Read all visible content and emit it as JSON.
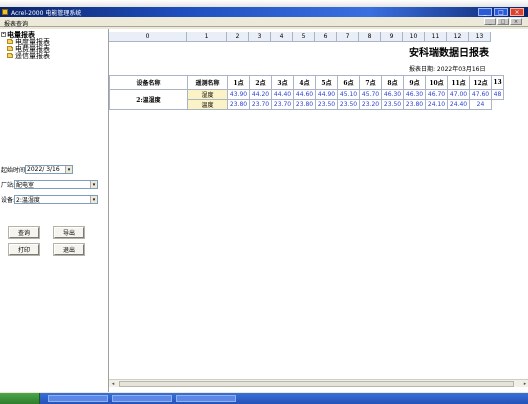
{
  "window": {
    "title": "Acrel-2000 电能管理系统",
    "controls": [
      "_",
      "□",
      "×"
    ]
  },
  "menubar": {
    "item": "报表查询",
    "mdi_controls": [
      "_",
      "□",
      "×"
    ]
  },
  "tree": {
    "root": "电量报表",
    "expander": "-",
    "items": [
      "电度量报表",
      "电费量报表",
      "遥信量报表"
    ]
  },
  "query": {
    "start_label": "起始时间:",
    "start_value": "2022/ 3/16",
    "station_label": "厂站:",
    "station_value": "配电室",
    "device_label": "设备:",
    "device_value": "2:温湿度",
    "buttons": {
      "query": "查询",
      "export": "导出",
      "print": "打印",
      "exit": "退出"
    },
    "dropdown_glyph": "▾"
  },
  "report": {
    "column_headers": [
      "0",
      "1",
      "2",
      "3",
      "4",
      "5",
      "6",
      "7",
      "8",
      "9",
      "10",
      "11",
      "12",
      "13"
    ],
    "title": "安科瑞数据日报表",
    "date": "报表日期: 2022年03月16日",
    "table": {
      "headers": [
        "设备名称",
        "遥测名称",
        "1点",
        "2点",
        "3点",
        "4点",
        "5点",
        "6点",
        "7点",
        "8点",
        "9点",
        "10点",
        "11点",
        "12点",
        "13"
      ],
      "device": "2:温湿度",
      "rows": [
        {
          "metric": "湿度",
          "values": [
            "43.90",
            "44.20",
            "44.40",
            "44.60",
            "44.90",
            "45.10",
            "45.70",
            "46.30",
            "46.30",
            "46.70",
            "47.00",
            "47.60",
            "48"
          ]
        },
        {
          "metric": "温度",
          "values": [
            "23.80",
            "23.70",
            "23.70",
            "23.80",
            "23.50",
            "23.50",
            "23.20",
            "23.50",
            "23.80",
            "24.10",
            "24.40",
            "24"
          ]
        }
      ]
    }
  },
  "scrollbar": {
    "left_arrow": "◂",
    "right_arrow": "▸"
  },
  "colors": {
    "titlebar": "#0a246a",
    "value_text": "#2c3fd0",
    "metric_cell": "#fbf3c6"
  }
}
